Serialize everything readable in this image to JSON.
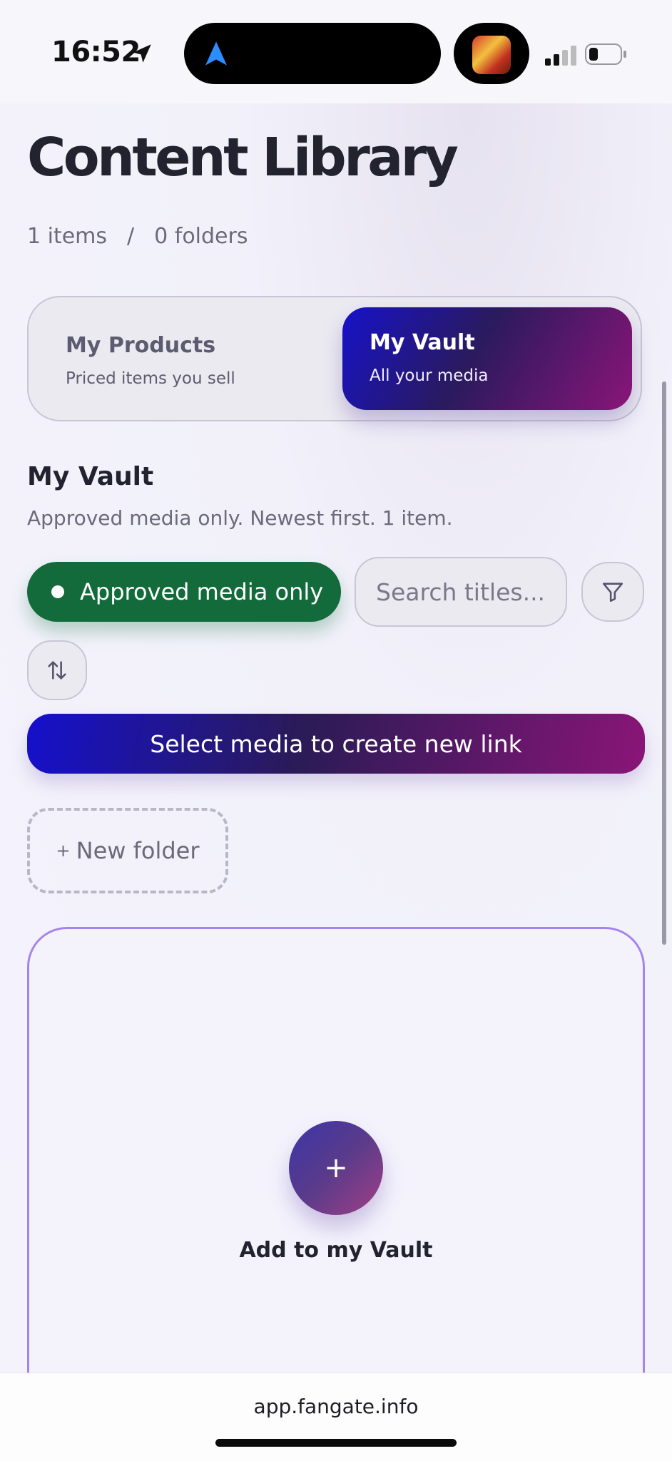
{
  "status_bar": {
    "time": "16:52",
    "icons": [
      "location-arrow-icon",
      "navigation-icon",
      "album-art",
      "signal-icon",
      "battery-icon"
    ]
  },
  "header": {
    "title": "Content Library",
    "items_count": "1 items",
    "separator": "/",
    "folders_count": "0 folders"
  },
  "tabs": [
    {
      "title": "My Products",
      "subtitle": "Priced items you sell",
      "active": false
    },
    {
      "title": "My Vault",
      "subtitle": "All your media",
      "active": true
    }
  ],
  "section": {
    "title": "My Vault",
    "description": "Approved media only. Newest first. 1 item."
  },
  "toolbar": {
    "approved_chip": "Approved media only",
    "search_placeholder": "Search titles...",
    "filter_icon": "filter-icon",
    "sort_icon": "sort-icon"
  },
  "cta": {
    "label": "Select media to create new link"
  },
  "new_folder": {
    "plus": "+",
    "label": "New folder"
  },
  "vault_add": {
    "icon_label": "+",
    "label": "Add to my Vault"
  },
  "browser": {
    "url": "app.fangate.info"
  },
  "colors": {
    "accent_start": "#1712c9",
    "accent_end": "#8a1578",
    "approved_green": "#136a3a",
    "dropzone_border": "#a584ec"
  }
}
